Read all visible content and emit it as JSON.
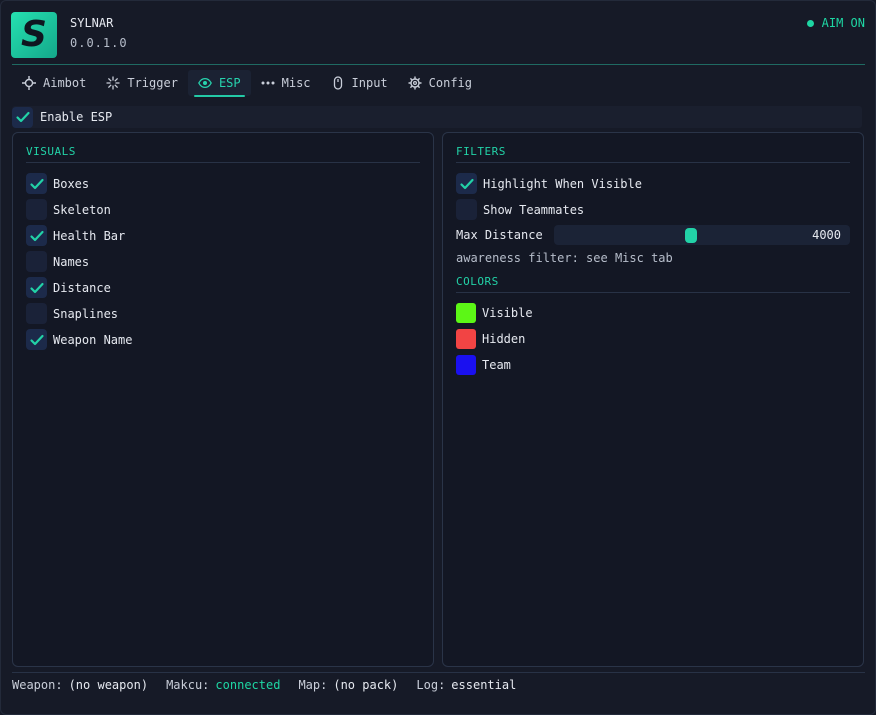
{
  "app": {
    "logo_letter": "S",
    "name": "SYLNAR",
    "version": "0.0.1.0",
    "aim_status": "AIM ON",
    "accent": "#22d2a7"
  },
  "tabs": [
    {
      "label": "Aimbot",
      "icon": "crosshair-icon"
    },
    {
      "label": "Trigger",
      "icon": "burst-icon"
    },
    {
      "label": "ESP",
      "icon": "eye-icon",
      "active": true
    },
    {
      "label": "Misc",
      "icon": "dots-icon"
    },
    {
      "label": "Input",
      "icon": "mouse-icon"
    },
    {
      "label": "Config",
      "icon": "gear-icon"
    }
  ],
  "enable_esp": {
    "label": "Enable ESP",
    "checked": true
  },
  "visuals": {
    "title": "VISUALS",
    "items": [
      {
        "label": "Boxes",
        "checked": true
      },
      {
        "label": "Skeleton",
        "checked": false
      },
      {
        "label": "Health Bar",
        "checked": true
      },
      {
        "label": "Names",
        "checked": false
      },
      {
        "label": "Distance",
        "checked": true
      },
      {
        "label": "Snaplines",
        "checked": false
      },
      {
        "label": "Weapon Name",
        "checked": true
      }
    ]
  },
  "filters": {
    "title": "FILTERS",
    "items": [
      {
        "label": "Highlight When Visible",
        "checked": true
      },
      {
        "label": "Show Teammates",
        "checked": false
      }
    ],
    "max_distance": {
      "label": "Max Distance",
      "value": "4000",
      "fraction": 0.46
    },
    "note": "awareness filter: see Misc tab"
  },
  "colors": {
    "title": "COLORS",
    "items": [
      {
        "label": "Visible",
        "color": "#5cf716"
      },
      {
        "label": "Hidden",
        "color": "#f24444"
      },
      {
        "label": "Team",
        "color": "#1a10f0"
      }
    ]
  },
  "footer": {
    "weapon_label": "Weapon:",
    "weapon_value": "(no weapon)",
    "makcu_label": "Makcu:",
    "makcu_value": "connected",
    "map_label": "Map:",
    "map_value": "(no pack)",
    "log_label": "Log:",
    "log_value": "essential"
  }
}
